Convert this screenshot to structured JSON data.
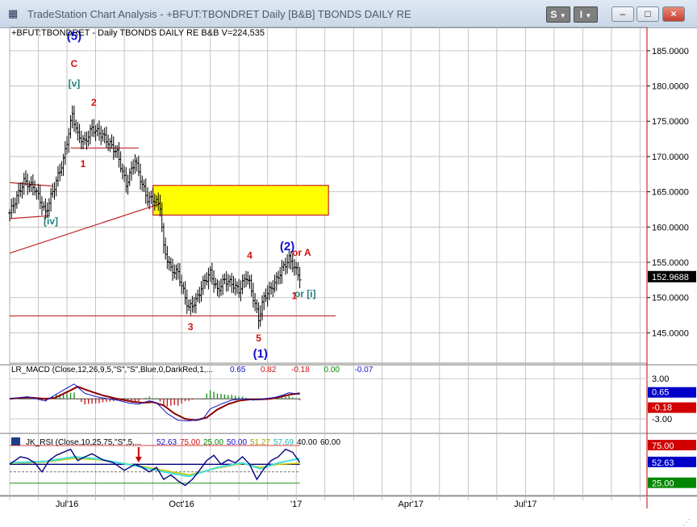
{
  "window": {
    "title": "TradeStation Chart Analysis - +BFUT:TBONDRET Daily [B&B] TBONDS DAILY RE",
    "s_button": "S",
    "i_button": "I",
    "minimize_label": "–",
    "maximize_label": "□",
    "close_label": "×"
  },
  "chart_header": "+BFUT:TBONDRET - Daily  TBONDS DAILY RE  B&B  V=224,535",
  "colors": {
    "bar": "#000000",
    "trendline": "#c0282a",
    "box_fill": "#ffff00",
    "wave_blue": "#1010d0",
    "wave_red": "#d01010",
    "wave_teal": "#208080",
    "macd_line": "#1010c0",
    "macd_signal": "#8b0000",
    "rsi_main": "#000080",
    "rsi_cyan": "#40e0e0",
    "rsi_yellow": "#c8c800",
    "rsi_hline": "#c80000"
  },
  "chart_data": [
    {
      "type": "ohlc",
      "name": "price",
      "header": "+BFUT:TBONDRET - Daily  TBONDS DAILY RE  B&B  V=224,535",
      "x_labels": [
        "Jul'16",
        "Oct'16",
        "'17",
        "Apr'17",
        "Jul'17"
      ],
      "x_label_index": [
        32,
        96,
        160,
        224,
        288
      ],
      "y_ticks": [
        "185.0000",
        "180.0000",
        "175.0000",
        "170.0000",
        "165.0000",
        "160.0000",
        "155.0000",
        "150.0000",
        "145.0000"
      ],
      "y_tick_values": [
        185,
        180,
        175,
        170,
        165,
        160,
        155,
        150,
        145
      ],
      "ylim": [
        140.7,
        188.3
      ],
      "last_price": "152.9688",
      "close_anchors": [
        [
          0,
          162.0
        ],
        [
          8,
          166.5
        ],
        [
          14,
          165.5
        ],
        [
          20,
          162.0
        ],
        [
          24,
          165.0
        ],
        [
          30,
          169.5
        ],
        [
          35,
          176.0
        ],
        [
          38,
          173.0
        ],
        [
          42,
          172.0
        ],
        [
          46,
          174.0
        ],
        [
          52,
          173.0
        ],
        [
          60,
          170.5
        ],
        [
          65,
          166.0
        ],
        [
          70,
          169.5
        ],
        [
          74,
          166.0
        ],
        [
          77,
          164.0
        ],
        [
          80,
          164.0
        ],
        [
          84,
          163.0
        ],
        [
          86,
          157.0
        ],
        [
          90,
          154.0
        ],
        [
          94,
          153.5
        ],
        [
          98,
          150.0
        ],
        [
          100,
          148.5
        ],
        [
          104,
          149.5
        ],
        [
          108,
          152.0
        ],
        [
          112,
          153.5
        ],
        [
          116,
          151.0
        ],
        [
          120,
          152.5
        ],
        [
          124,
          152.0
        ],
        [
          128,
          151.0
        ],
        [
          132,
          153.0
        ],
        [
          134,
          152.0
        ],
        [
          136,
          150.0
        ],
        [
          139,
          147.0
        ],
        [
          142,
          150.0
        ],
        [
          145,
          151.0
        ],
        [
          148,
          152.0
        ],
        [
          152,
          154.0
        ],
        [
          156,
          155.5
        ],
        [
          160,
          153.8
        ],
        [
          162,
          152.9
        ]
      ],
      "annotations": [
        {
          "text": "(5)",
          "color": "blue",
          "idx": 36,
          "y": 186.5
        },
        {
          "text": "C",
          "color": "red",
          "idx": 36,
          "y": 182.7
        },
        {
          "text": "[v]",
          "color": "teal",
          "idx": 36,
          "y": 179.9
        },
        {
          "text": "2",
          "color": "red",
          "idx": 47,
          "y": 177.2
        },
        {
          "text": "1",
          "color": "red",
          "idx": 41,
          "y": 168.5
        },
        {
          "text": "[iv]",
          "color": "teal",
          "idx": 23,
          "y": 160.4
        },
        {
          "text": "3",
          "color": "red",
          "idx": 101,
          "y": 145.4
        },
        {
          "text": "4",
          "color": "red",
          "idx": 134,
          "y": 155.5
        },
        {
          "text": "5",
          "color": "red",
          "idx": 139,
          "y": 143.8
        },
        {
          "text": "(1)",
          "color": "blue",
          "idx": 140,
          "y": 141.5
        },
        {
          "text": "(2)",
          "color": "blue",
          "idx": 155,
          "y": 156.7
        },
        {
          "text": "or A",
          "color": "red",
          "idx": 163,
          "y": 155.9
        },
        {
          "text": "1",
          "color": "red",
          "idx": 159,
          "y": 149.8
        },
        {
          "text": "or [i]",
          "color": "teal",
          "idx": 165,
          "y": 150.1
        }
      ],
      "rectangle": {
        "idx_start": 80,
        "idx_end": 178,
        "y_top": 165.9,
        "y_bottom": 161.7
      },
      "lines": [
        {
          "idx1": 0,
          "y1": 166.3,
          "idx2": 24,
          "y2": 165.8
        },
        {
          "idx1": 0,
          "y1": 161.2,
          "idx2": 22,
          "y2": 161.6
        },
        {
          "idx1": 34,
          "y1": 171.2,
          "idx2": 72,
          "y2": 171.2
        },
        {
          "idx1": 0,
          "y1": 156.3,
          "idx2": 84,
          "y2": 163.3
        },
        {
          "idx1": 0,
          "y1": 147.4,
          "idx2": 182,
          "y2": 147.4
        }
      ]
    },
    {
      "type": "line",
      "name": "macd",
      "label": "LR_MACD (Close,12,26,9,5,\"S\",\"S\",Blue,0,DarkRed,1,...",
      "values_text": [
        "0.65",
        "0.82",
        "-0.18",
        "0.00",
        "-0.07"
      ],
      "values_colors": [
        "blue",
        "red",
        "red",
        "green",
        "blue"
      ],
      "y_ticks": [
        "3.00",
        "-3.00"
      ],
      "y_tick_values": [
        3,
        -3
      ],
      "ylim": [
        -4.8,
        4.1
      ],
      "badges": [
        {
          "text": "0.65",
          "value": 0.65,
          "color": "#0000c8"
        },
        {
          "text": "-0.18",
          "value": -0.18,
          "color": "#d00000"
        }
      ],
      "macd_anchors": [
        [
          0,
          0.0
        ],
        [
          10,
          0.3
        ],
        [
          20,
          -0.3
        ],
        [
          25,
          0.5
        ],
        [
          32,
          1.6
        ],
        [
          36,
          2.2
        ],
        [
          42,
          0.8
        ],
        [
          50,
          0.2
        ],
        [
          60,
          -0.2
        ],
        [
          66,
          -0.6
        ],
        [
          72,
          -0.8
        ],
        [
          78,
          -0.3
        ],
        [
          82,
          -0.6
        ],
        [
          88,
          -2.2
        ],
        [
          94,
          -3.2
        ],
        [
          100,
          -3.3
        ],
        [
          108,
          -3.0
        ],
        [
          112,
          -1.5
        ],
        [
          118,
          -0.8
        ],
        [
          124,
          -0.2
        ],
        [
          130,
          0.0
        ],
        [
          136,
          -0.2
        ],
        [
          142,
          0.0
        ],
        [
          148,
          0.2
        ],
        [
          152,
          0.5
        ],
        [
          156,
          0.9
        ],
        [
          162,
          0.65
        ]
      ],
      "signal_anchors": [
        [
          0,
          0.0
        ],
        [
          10,
          0.2
        ],
        [
          20,
          0.0
        ],
        [
          25,
          0.1
        ],
        [
          32,
          1.0
        ],
        [
          38,
          1.8
        ],
        [
          44,
          1.2
        ],
        [
          52,
          0.5
        ],
        [
          60,
          0.0
        ],
        [
          68,
          -0.4
        ],
        [
          74,
          -0.6
        ],
        [
          80,
          -0.5
        ],
        [
          86,
          -1.0
        ],
        [
          92,
          -2.2
        ],
        [
          98,
          -3.0
        ],
        [
          104,
          -3.2
        ],
        [
          110,
          -2.8
        ],
        [
          116,
          -1.6
        ],
        [
          122,
          -0.8
        ],
        [
          128,
          -0.3
        ],
        [
          134,
          -0.1
        ],
        [
          140,
          -0.1
        ],
        [
          146,
          0.0
        ],
        [
          150,
          0.2
        ],
        [
          156,
          0.6
        ],
        [
          162,
          0.82
        ]
      ]
    },
    {
      "type": "line",
      "name": "rsi",
      "label": "JK_RSI (Close,10,25,75,\"S\",5,...",
      "values_text": [
        "52.63",
        "75.00",
        "25.00",
        "50.00",
        "51.27",
        "57.69",
        "40.00",
        "60.00"
      ],
      "values_colors": [
        "blue",
        "red",
        "green",
        "blue",
        "yellow",
        "cyan",
        "black",
        "black"
      ],
      "ylim": [
        15,
        90
      ],
      "hline_values": [
        75,
        50,
        40,
        25
      ],
      "badges": [
        {
          "text": "75.00",
          "value": 75,
          "color": "#d00000"
        },
        {
          "text": "52.63",
          "value": 52.63,
          "color": "#0000c8"
        },
        {
          "text": "25.00",
          "value": 25,
          "color": "#008800"
        }
      ],
      "arrow_idx": 72,
      "rsi_anchors": [
        [
          0,
          50
        ],
        [
          6,
          60
        ],
        [
          10,
          58
        ],
        [
          14,
          52
        ],
        [
          18,
          40
        ],
        [
          22,
          55
        ],
        [
          26,
          62
        ],
        [
          30,
          66
        ],
        [
          34,
          70
        ],
        [
          38,
          55
        ],
        [
          42,
          60
        ],
        [
          46,
          64
        ],
        [
          52,
          56
        ],
        [
          58,
          52
        ],
        [
          64,
          42
        ],
        [
          70,
          50
        ],
        [
          74,
          46
        ],
        [
          78,
          40
        ],
        [
          82,
          46
        ],
        [
          86,
          30
        ],
        [
          90,
          36
        ],
        [
          94,
          28
        ],
        [
          98,
          22
        ],
        [
          102,
          30
        ],
        [
          106,
          42
        ],
        [
          110,
          55
        ],
        [
          114,
          62
        ],
        [
          118,
          50
        ],
        [
          122,
          56
        ],
        [
          126,
          52
        ],
        [
          130,
          60
        ],
        [
          134,
          50
        ],
        [
          138,
          30
        ],
        [
          142,
          44
        ],
        [
          146,
          55
        ],
        [
          150,
          60
        ],
        [
          154,
          70
        ],
        [
          158,
          66
        ],
        [
          162,
          52.63
        ]
      ],
      "cyan_anchors": [
        [
          0,
          52
        ],
        [
          20,
          54
        ],
        [
          36,
          60
        ],
        [
          50,
          57
        ],
        [
          70,
          48
        ],
        [
          86,
          40
        ],
        [
          100,
          34
        ],
        [
          116,
          46
        ],
        [
          130,
          52
        ],
        [
          140,
          44
        ],
        [
          150,
          52
        ],
        [
          162,
          57.69
        ]
      ],
      "yellow_anchors": [
        [
          0,
          51
        ],
        [
          20,
          53
        ],
        [
          36,
          58
        ],
        [
          50,
          56
        ],
        [
          70,
          49
        ],
        [
          86,
          42
        ],
        [
          100,
          36
        ],
        [
          116,
          45
        ],
        [
          130,
          51
        ],
        [
          140,
          46
        ],
        [
          150,
          50
        ],
        [
          162,
          51.27
        ]
      ]
    }
  ]
}
